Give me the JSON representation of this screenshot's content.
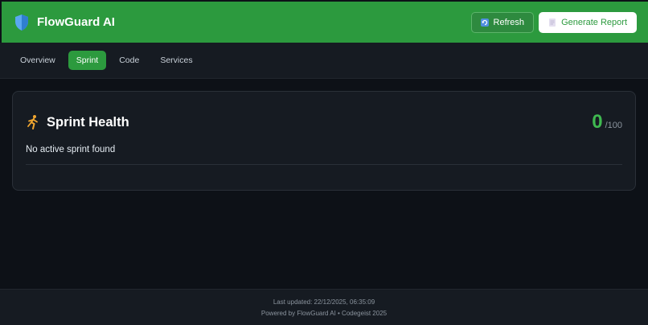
{
  "header": {
    "title": "FlowGuard AI",
    "logo_icon": "shield-icon",
    "refresh_label": "Refresh",
    "refresh_icon": "refresh-icon",
    "report_label": "Generate Report",
    "report_icon": "document-icon"
  },
  "tabs": [
    {
      "label": "Overview",
      "active": false
    },
    {
      "label": "Sprint",
      "active": true
    },
    {
      "label": "Code",
      "active": false
    },
    {
      "label": "Services",
      "active": false
    }
  ],
  "sprint_card": {
    "icon": "runner-icon",
    "title": "Sprint Health",
    "score": "0",
    "score_max": "/100",
    "message": "No active sprint found"
  },
  "footer": {
    "last_updated": "Last updated: 22/12/2025, 06:35:09",
    "powered_by": "Powered by FlowGuard AI • Codegeist 2025"
  },
  "colors": {
    "brand_green": "#2c9a3e",
    "score_green": "#3fb950",
    "background": "#0d1117",
    "surface": "#161b22"
  }
}
